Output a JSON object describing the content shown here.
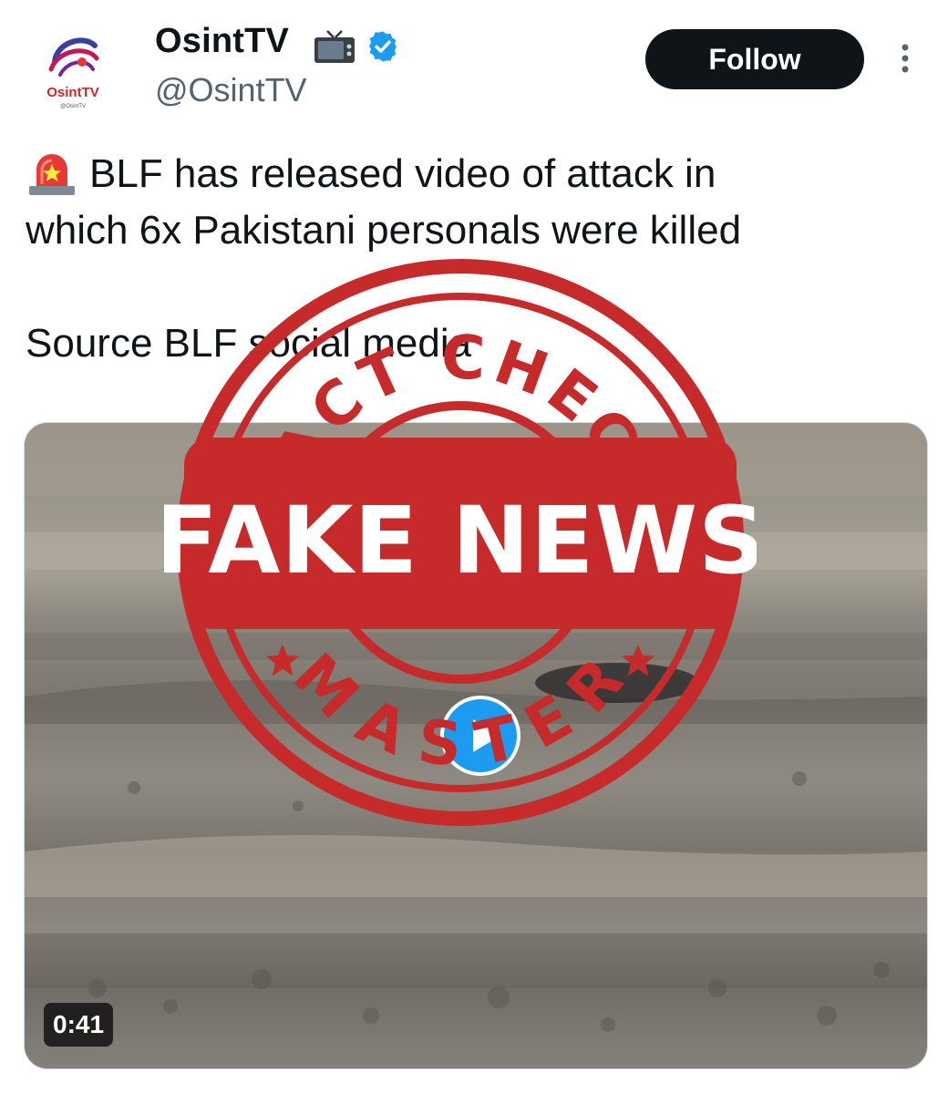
{
  "author": {
    "display_name": "OsintTV",
    "handle": "@OsintTV",
    "avatar_logo_text": "OsintTV",
    "avatar_logo_subtext": "@OsintTV"
  },
  "follow_button_label": "Follow",
  "tweet": {
    "line1": "BLF has released video of attack in",
    "line2": "which 6x Pakistani personals were killed",
    "line3": "Source BLF social media"
  },
  "media": {
    "type": "video",
    "duration": "0:41"
  },
  "stamp": {
    "top_text": "FACT CHECK",
    "center_text": "FAKE NEWS",
    "bottom_text": "MASTER",
    "color": "#c62a2a"
  },
  "icons": {
    "siren": "police-light-icon",
    "tv": "television-icon",
    "verified": "verified-badge-icon",
    "more": "more-vertical-icon"
  },
  "colors": {
    "follow_bg": "#0f1419",
    "verified": "#1d9bf0",
    "handle": "#536471"
  }
}
